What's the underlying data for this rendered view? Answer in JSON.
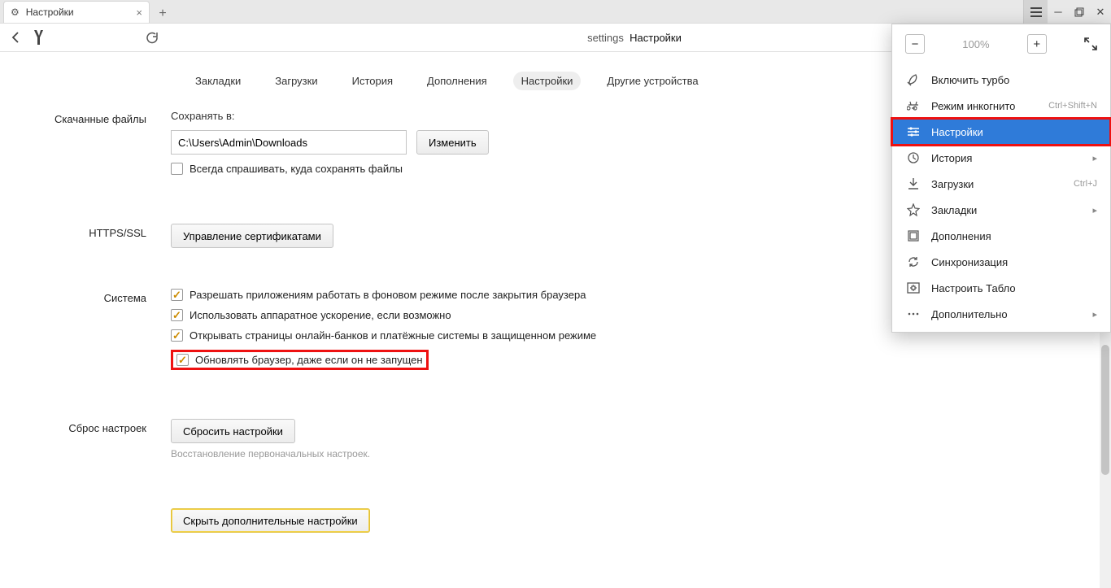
{
  "tab": {
    "title": "Настройки"
  },
  "omnibox": {
    "prefix": "settings",
    "title": "Настройки"
  },
  "settings_nav": {
    "items": [
      {
        "label": "Закладки"
      },
      {
        "label": "Загрузки"
      },
      {
        "label": "История"
      },
      {
        "label": "Дополнения"
      },
      {
        "label": "Настройки",
        "active": true
      },
      {
        "label": "Другие устройства"
      }
    ]
  },
  "sections": {
    "downloads": {
      "label": "Скачанные файлы",
      "save_to_label": "Сохранять в:",
      "path": "C:\\Users\\Admin\\Downloads",
      "change_btn": "Изменить",
      "ask_label": "Всегда спрашивать, куда сохранять файлы"
    },
    "https": {
      "label": "HTTPS/SSL",
      "cert_btn": "Управление сертификатами"
    },
    "system": {
      "label": "Система",
      "opts": [
        "Разрешать приложениям работать в фоновом режиме после закрытия браузера",
        "Использовать аппаратное ускорение, если возможно",
        "Открывать страницы онлайн-банков и платёжные системы в защищенном режиме",
        "Обновлять браузер, даже если он не запущен"
      ]
    },
    "reset": {
      "label": "Сброс настроек",
      "btn": "Сбросить настройки",
      "hint": "Восстановление первоначальных настроек."
    },
    "hide_btn": "Скрыть дополнительные настройки"
  },
  "menu": {
    "zoom": {
      "value": "100%"
    },
    "items": [
      {
        "icon": "rocket",
        "label": "Включить турбо"
      },
      {
        "icon": "incognito",
        "label": "Режим инкогнито",
        "shortcut": "Ctrl+Shift+N"
      },
      {
        "icon": "sliders",
        "label": "Настройки",
        "selected": true,
        "highlight": true
      },
      {
        "icon": "clock",
        "label": "История",
        "chevron": true
      },
      {
        "icon": "download",
        "label": "Загрузки",
        "shortcut": "Ctrl+J"
      },
      {
        "icon": "star",
        "label": "Закладки",
        "chevron": true
      },
      {
        "icon": "puzzle",
        "label": "Дополнения"
      },
      {
        "icon": "sync",
        "label": "Синхронизация"
      },
      {
        "icon": "tableau",
        "label": "Настроить Табло"
      },
      {
        "icon": "dots",
        "label": "Дополнительно",
        "chevron": true
      }
    ]
  },
  "ext_badges": {
    "q": "?"
  }
}
